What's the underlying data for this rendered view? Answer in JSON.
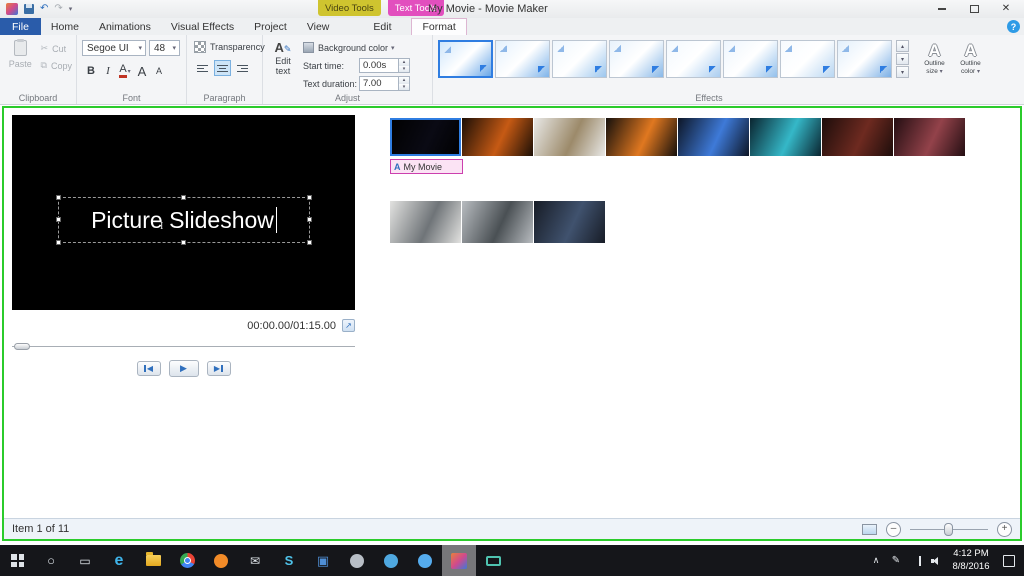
{
  "window": {
    "title": "My Movie - Movie Maker",
    "contextual_tabs": [
      {
        "label": "Video Tools",
        "bg": "#cfc42f",
        "fg": "#4a4410"
      },
      {
        "label": "Text Tools",
        "bg": "#e24fbe",
        "fg": "#ffffff"
      }
    ]
  },
  "tabs": {
    "file": "File",
    "items": [
      "Home",
      "Animations",
      "Visual Effects",
      "Project",
      "View"
    ],
    "contextual": [
      {
        "label": "Edit",
        "selected": false
      },
      {
        "label": "Format",
        "selected": true
      }
    ]
  },
  "icons": {
    "dropdown": "▾",
    "scroll_up": "▴",
    "scroll_down": "▾",
    "gallery_more": "▾",
    "cut": "✂",
    "copy": "⧉",
    "undo": "↶",
    "redo": "↷",
    "help": "?",
    "close": "✕",
    "play": "▶",
    "prev": "◀",
    "next": "▶",
    "fullscreen": "↗",
    "pencil": "✎",
    "minus": "–",
    "plus": "+"
  },
  "ribbon": {
    "clipboard": {
      "label": "Clipboard",
      "paste": "Paste",
      "cut": "Cut",
      "copy": "Copy"
    },
    "font": {
      "label": "Font",
      "family": "Segoe UI",
      "size": "48",
      "bold": "B",
      "italic": "I",
      "color_glyph": "A",
      "grow_glyph": "A",
      "shrink_glyph": "A"
    },
    "paragraph": {
      "label": "Paragraph",
      "transparency": "Transparency"
    },
    "adjust": {
      "label": "Adjust",
      "edit_text": "Edit text",
      "background_color": "Background color",
      "start_time_label": "Start time:",
      "start_time_value": "0.00s",
      "text_duration_label": "Text duration:",
      "text_duration_value": "7.00"
    },
    "effects": {
      "label": "Effects",
      "items": [
        {
          "selected": true,
          "c1": "#cfe6fb",
          "c2": "#6aa8e8"
        },
        {
          "selected": false,
          "c1": "#e4f1fc",
          "c2": "#7fb4ea"
        },
        {
          "selected": false,
          "c1": "#eef6fd",
          "c2": "#9cc6ee"
        },
        {
          "selected": false,
          "c1": "#e8f2fb",
          "c2": "#88b8e8"
        },
        {
          "selected": false,
          "c1": "#f2f8fe",
          "c2": "#aacdf0"
        },
        {
          "selected": false,
          "c1": "#edf5fd",
          "c2": "#93c0ec"
        },
        {
          "selected": false,
          "c1": "#f6fafe",
          "c2": "#b8d6f2"
        },
        {
          "selected": false,
          "c1": "#e2effb",
          "c2": "#7cb0e6"
        }
      ]
    },
    "outline": {
      "size_label": "Outline size",
      "color_label": "Outline color",
      "glyph": "A"
    }
  },
  "preview": {
    "title_text": "Picture Slideshow",
    "time": "00:00.00/01:15.00"
  },
  "storyboard": {
    "clip_label": "My Movie",
    "icon_glyph": "A",
    "row1": [
      {
        "selected": true,
        "c1": "#000000",
        "c2": "#0a0a14"
      },
      {
        "selected": false,
        "c1": "#1c0f06",
        "c2": "#c65a14"
      },
      {
        "selected": false,
        "c1": "#e8e8e6",
        "c2": "#9c8a6a"
      },
      {
        "selected": false,
        "c1": "#15100c",
        "c2": "#e07820"
      },
      {
        "selected": false,
        "c1": "#0d1626",
        "c2": "#3e7ad8"
      },
      {
        "selected": false,
        "c1": "#0a2530",
        "c2": "#35b8c8"
      },
      {
        "selected": false,
        "c1": "#1d0d0b",
        "c2": "#6e2a20"
      },
      {
        "selected": false,
        "c1": "#240e12",
        "c2": "#93424a"
      }
    ],
    "row2": [
      {
        "selected": false,
        "c1": "#e2e2e0",
        "c2": "#6f7478"
      },
      {
        "selected": false,
        "c1": "#b8bcc0",
        "c2": "#4a5054"
      },
      {
        "selected": false,
        "c1": "#171c26",
        "c2": "#40526e"
      }
    ]
  },
  "statusbar": {
    "item_text": "Item 1 of 11"
  },
  "taskbar": {
    "time": "4:12 PM",
    "date": "8/8/2016",
    "icons": [
      {
        "name": "start-icon",
        "type": "win"
      },
      {
        "name": "search-icon",
        "type": "glyph",
        "glyph": "○",
        "color": "#dfe5ea",
        "size": 13
      },
      {
        "name": "task-view-icon",
        "type": "glyph",
        "glyph": "▭",
        "color": "#dfe5ea",
        "size": 12
      },
      {
        "name": "edge-icon",
        "type": "glyph",
        "glyph": "e",
        "color": "#3fb4ea",
        "size": 16,
        "bold": true
      },
      {
        "name": "file-explorer-icon",
        "type": "folder"
      },
      {
        "name": "chrome-icon",
        "type": "chrome"
      },
      {
        "name": "firefox-icon",
        "type": "circle",
        "color": "#f28b28"
      },
      {
        "name": "mail-icon",
        "type": "glyph",
        "glyph": "✉",
        "color": "#dfe5ea",
        "size": 12
      },
      {
        "name": "skype-icon",
        "type": "glyph",
        "glyph": "S",
        "color": "#4fc3ea",
        "size": 13,
        "bold": true
      },
      {
        "name": "app-blue-icon",
        "type": "glyph",
        "glyph": "▣",
        "color": "#4f8fd6",
        "size": 13
      },
      {
        "name": "steam-icon",
        "type": "circle",
        "color": "#b8bec6"
      },
      {
        "name": "messaging-app-icon",
        "type": "circle",
        "color": "#4fa8e0"
      },
      {
        "name": "twitter-icon",
        "type": "circle",
        "color": "#55acee"
      },
      {
        "name": "movie-maker-icon",
        "type": "mm",
        "active": true
      },
      {
        "name": "screen-share-icon",
        "type": "monitor",
        "color": "#4fc3b0"
      }
    ],
    "tray": [
      {
        "name": "tray-expand-icon",
        "type": "glyph",
        "glyph": "∧",
        "color": "#e4e8ec",
        "size": 9
      },
      {
        "name": "pen-icon",
        "type": "glyph",
        "glyph": "✎",
        "color": "#e4e8ec",
        "size": 10
      },
      {
        "name": "network-icon",
        "type": "bars"
      },
      {
        "name": "volume-icon",
        "type": "spk"
      }
    ]
  }
}
